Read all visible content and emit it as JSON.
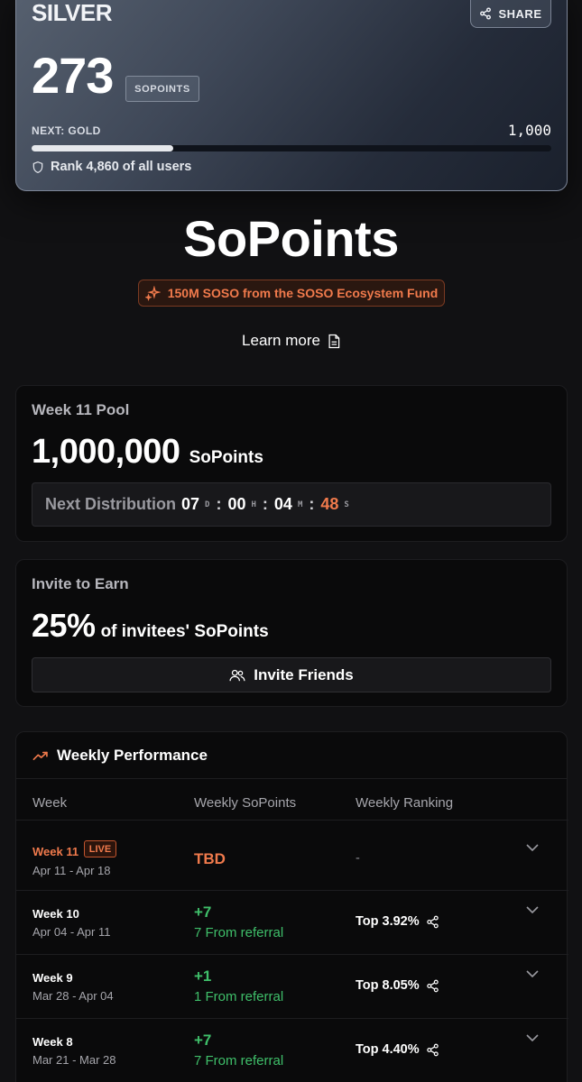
{
  "tier": {
    "name": "SILVER",
    "share_label": "SHARE",
    "points": "273",
    "points_unit": "SOPOINTS",
    "next_label": "NEXT: GOLD",
    "next_target": "1,000",
    "progress_fraction": 0.273,
    "rank_text": "Rank 4,860 of all users"
  },
  "hero": {
    "title": "SoPoints",
    "fund_badge": "150M SOSO from the SOSO Ecosystem Fund",
    "learn_more": "Learn more"
  },
  "pool": {
    "label": "Week 11 Pool",
    "amount": "1,000,000",
    "unit": "SoPoints",
    "next_distribution_label": "Next Distribution",
    "countdown": {
      "days": "07",
      "days_unit": "D",
      "hours": "00",
      "hours_unit": "H",
      "minutes": "04",
      "minutes_unit": "M",
      "seconds": "48",
      "seconds_unit": "S"
    }
  },
  "invite": {
    "label": "Invite to Earn",
    "percent": "25%",
    "description": "of invitees' SoPoints",
    "button_label": "Invite Friends"
  },
  "performance": {
    "title": "Weekly Performance",
    "columns": [
      "Week",
      "Weekly SoPoints",
      "Weekly Ranking"
    ],
    "live_label": "LIVE",
    "rows": [
      {
        "week": "Week 11",
        "range": "Apr 11 - Apr 18",
        "points": "TBD",
        "referral": "",
        "ranking": "-"
      },
      {
        "week": "Week 10",
        "range": "Apr 04 - Apr 11",
        "points": "+7",
        "referral": "7 From referral",
        "ranking": "Top 3.92%"
      },
      {
        "week": "Week 9",
        "range": "Mar 28 - Apr 04",
        "points": "+1",
        "referral": "1 From referral",
        "ranking": "Top 8.05%"
      },
      {
        "week": "Week 8",
        "range": "Mar 21 - Mar 28",
        "points": "+7",
        "referral": "7 From referral",
        "ranking": "Top 4.40%"
      }
    ]
  },
  "colors": {
    "accent_orange": "#f07a4c",
    "positive_green": "#3fbf6a",
    "background": "#111113"
  }
}
